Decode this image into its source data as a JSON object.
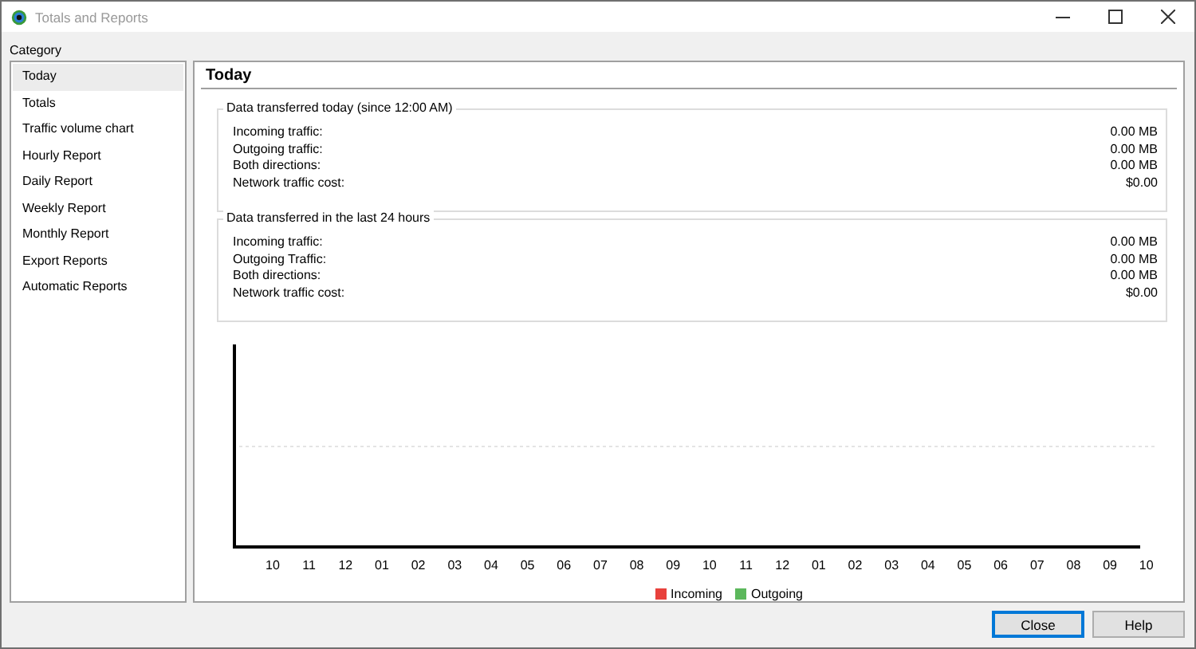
{
  "window": {
    "title": "Totals and Reports"
  },
  "sidebar": {
    "label": "Category",
    "items": [
      {
        "label": "Today",
        "selected": true
      },
      {
        "label": "Totals",
        "selected": false
      },
      {
        "label": "Traffic volume chart",
        "selected": false
      },
      {
        "label": "Hourly Report",
        "selected": false
      },
      {
        "label": "Daily Report",
        "selected": false
      },
      {
        "label": "Weekly Report",
        "selected": false
      },
      {
        "label": "Monthly Report",
        "selected": false
      },
      {
        "label": "Export Reports",
        "selected": false
      },
      {
        "label": "Automatic Reports",
        "selected": false
      }
    ]
  },
  "panel": {
    "title": "Today",
    "groups": [
      {
        "title": "Data transferred today (since 12:00 AM)",
        "rows": [
          {
            "label": "Incoming traffic:",
            "value": "0.00 MB"
          },
          {
            "label": "Outgoing traffic:",
            "value": "0.00 MB"
          },
          {
            "label": "Both directions:",
            "value": "0.00 MB"
          },
          {
            "label": "Network traffic cost:",
            "value": "$0.00"
          }
        ]
      },
      {
        "title": "Data transferred in the last 24 hours",
        "rows": [
          {
            "label": "Incoming traffic:",
            "value": "0.00 MB"
          },
          {
            "label": "Outgoing Traffic:",
            "value": "0.00 MB"
          },
          {
            "label": "Both directions:",
            "value": "0.00 MB"
          },
          {
            "label": "Network traffic cost:",
            "value": "$0.00"
          }
        ]
      }
    ],
    "chart": {
      "x_labels": [
        "10",
        "11",
        "12",
        "01",
        "02",
        "03",
        "04",
        "05",
        "06",
        "07",
        "08",
        "09",
        "10",
        "11",
        "12",
        "01",
        "02",
        "03",
        "04",
        "05",
        "06",
        "07",
        "08",
        "09",
        "10"
      ],
      "legend": [
        {
          "label": "Incoming",
          "color": "#e8413c"
        },
        {
          "label": "Outgoing",
          "color": "#5cb85c"
        }
      ]
    }
  },
  "buttons": [
    {
      "label": "Close",
      "default": true
    },
    {
      "label": "Help",
      "default": false
    }
  ]
}
